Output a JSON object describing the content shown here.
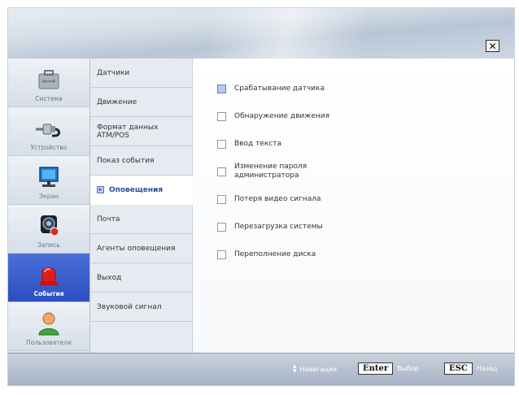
{
  "window": {
    "close_label": "✕"
  },
  "sidebar": {
    "items": [
      {
        "label": "Система",
        "icon": "toolbox-icon",
        "active": false
      },
      {
        "label": "Устройство",
        "icon": "cable-plug-icon",
        "active": false
      },
      {
        "label": "Экран",
        "icon": "monitor-icon",
        "active": false
      },
      {
        "label": "Запись",
        "icon": "record-camera-icon",
        "active": false
      },
      {
        "label": "События",
        "icon": "alarm-siren-icon",
        "active": true
      },
      {
        "label": "Пользователи",
        "icon": "user-icon",
        "active": false
      }
    ]
  },
  "submenu": {
    "items": [
      {
        "label": "Датчики",
        "active": false
      },
      {
        "label": "Движение",
        "active": false
      },
      {
        "label": "Формат данных ATM/POS",
        "active": false
      },
      {
        "label": "Показ события",
        "active": false
      },
      {
        "label": "Оповещения",
        "active": true
      },
      {
        "label": "Почта",
        "active": false
      },
      {
        "label": "Агенты оповещения",
        "active": false
      },
      {
        "label": "Выход",
        "active": false
      },
      {
        "label": "Звуковой сигнал",
        "active": false
      }
    ]
  },
  "options": [
    {
      "label": "Срабатывание датчика",
      "checked": false,
      "focused": true
    },
    {
      "label": "Обнаружение движения",
      "checked": false,
      "focused": false
    },
    {
      "label": "Ввод текста",
      "checked": false,
      "focused": false
    },
    {
      "label": "Изменение пароля администратора",
      "checked": false,
      "focused": false
    },
    {
      "label": "Потеря видео сигнала",
      "checked": false,
      "focused": false
    },
    {
      "label": "Перезагрузка системы",
      "checked": false,
      "focused": false
    },
    {
      "label": "Переполнение диска",
      "checked": false,
      "focused": false
    }
  ],
  "footer": {
    "nav_label": "Навигация",
    "enter_key": "Enter",
    "enter_label": "Выбор",
    "esc_key": "ESC",
    "esc_label": "Назад"
  },
  "colors": {
    "accent": "#2c4fbf",
    "focus": "#b4c9ec"
  }
}
